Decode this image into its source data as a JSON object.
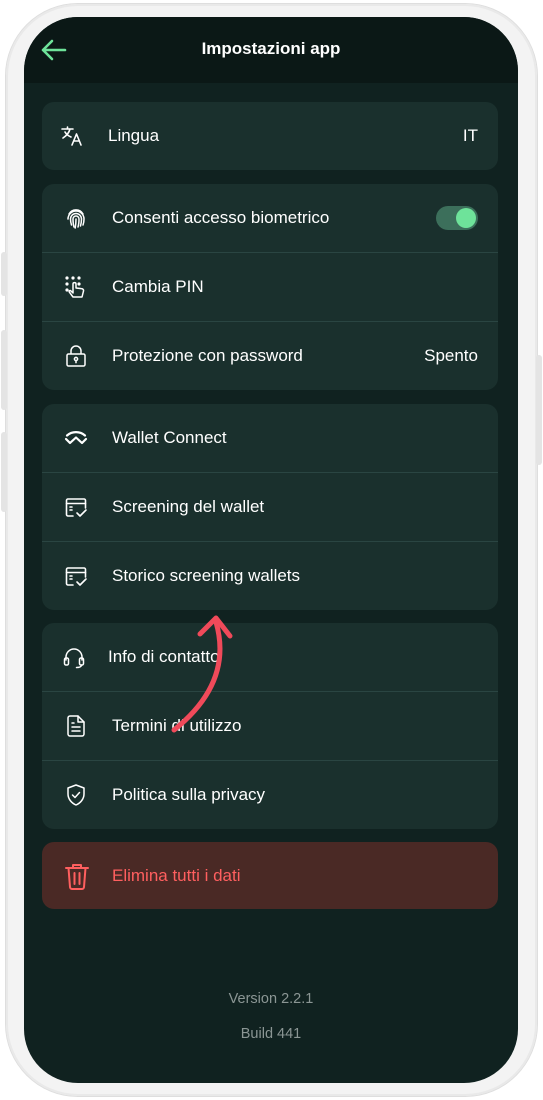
{
  "header": {
    "title": "Impostazioni app",
    "back_icon": "arrow-left-icon"
  },
  "language": {
    "label": "Lingua",
    "value": "IT",
    "icon": "translate-icon"
  },
  "security": {
    "biometric": {
      "label": "Consenti accesso biometrico",
      "enabled": true,
      "icon": "fingerprint-icon"
    },
    "change_pin": {
      "label": "Cambia PIN",
      "icon": "keypad-tap-icon"
    },
    "password": {
      "label": "Protezione con password",
      "value": "Spento",
      "icon": "lock-icon"
    }
  },
  "wallet": {
    "items": [
      {
        "label": "Wallet Connect",
        "icon": "walletconnect-icon"
      },
      {
        "label": "Screening del wallet",
        "icon": "screening-icon"
      },
      {
        "label": "Storico screening wallets",
        "icon": "screening-history-icon"
      }
    ]
  },
  "info": {
    "items": [
      {
        "label": "Info di contatto",
        "icon": "headset-icon"
      },
      {
        "label": "Termini di utilizzo",
        "icon": "document-icon"
      },
      {
        "label": "Politica sulla privacy",
        "icon": "shield-check-icon"
      }
    ]
  },
  "danger": {
    "label": "Elimina tutti i dati",
    "icon": "trash-icon"
  },
  "footer": {
    "version": "Version 2.2.1",
    "build": "Build 441"
  },
  "colors": {
    "background": "#102220",
    "card": "#1a302d",
    "accent": "#6ee39a",
    "danger_bg": "#4a2925",
    "danger_text": "#ff5f5f",
    "annotation_arrow": "#f04a5a"
  }
}
